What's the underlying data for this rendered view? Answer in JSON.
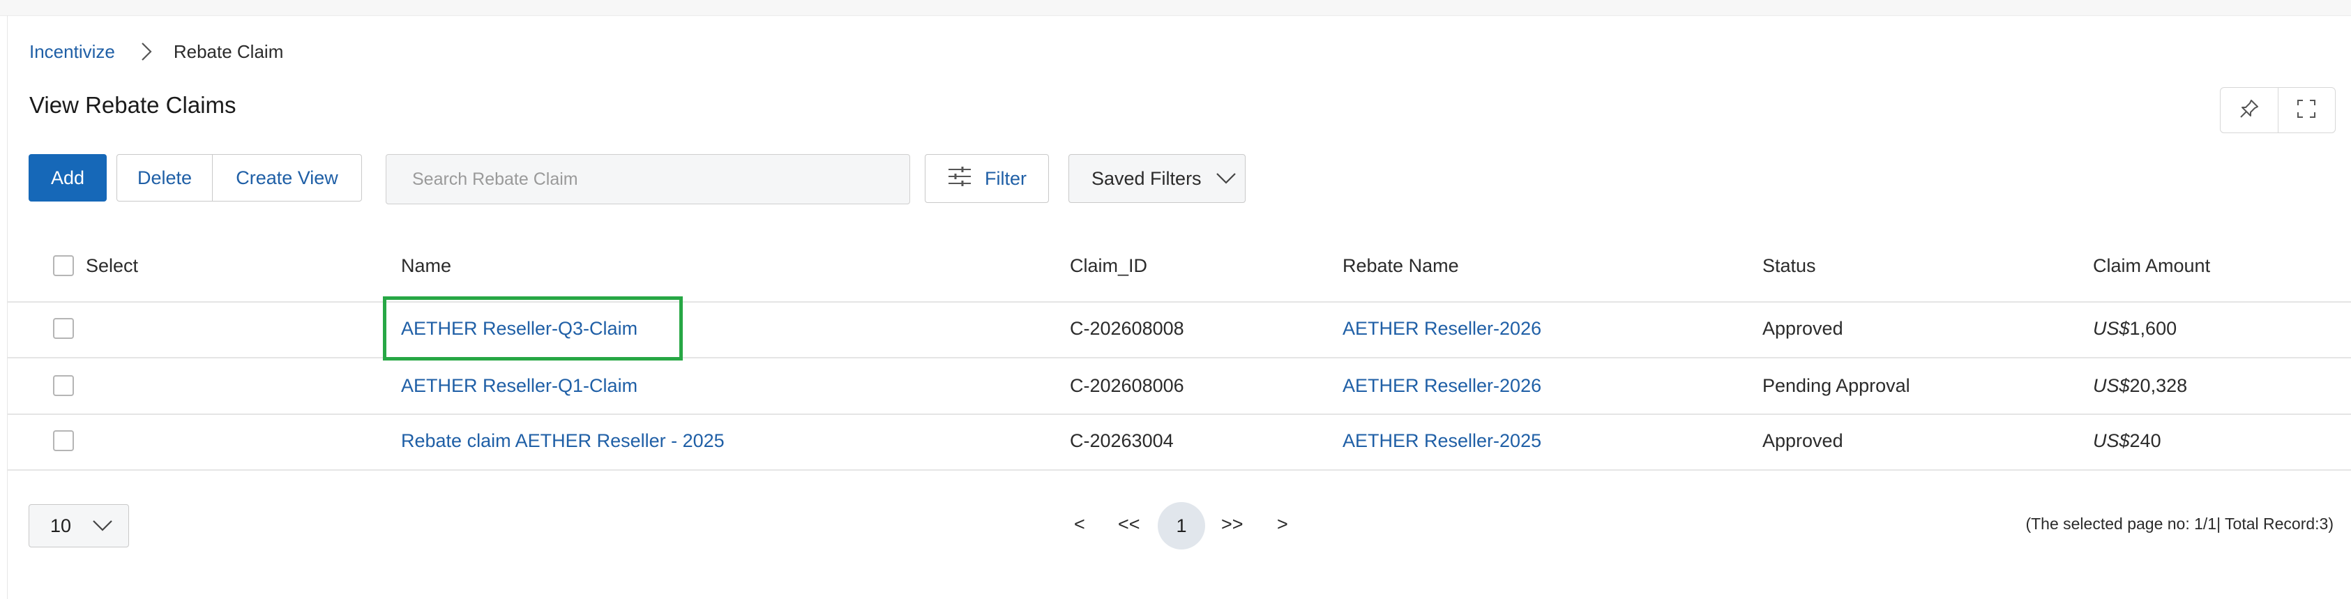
{
  "breadcrumb": {
    "root": "Incentivize",
    "current": "Rebate Claim"
  },
  "page": {
    "title": "View Rebate Claims"
  },
  "toolbar": {
    "add_label": "Add",
    "delete_label": "Delete",
    "create_view_label": "Create View",
    "search_placeholder": "Search Rebate Claim",
    "filter_label": "Filter",
    "saved_filters_label": "Saved Filters"
  },
  "table": {
    "headers": {
      "select": "Select",
      "name": "Name",
      "claim_id": "Claim_ID",
      "rebate_name": "Rebate Name",
      "status": "Status",
      "claim_amount": "Claim Amount"
    },
    "rows": [
      {
        "name": "AETHER Reseller-Q3-Claim",
        "claim_id": "C-202608008",
        "rebate_name": "AETHER Reseller-2026",
        "status": "Approved",
        "currency": "US$",
        "amount": "1,600"
      },
      {
        "name": "AETHER Reseller-Q1-Claim",
        "claim_id": "C-202608006",
        "rebate_name": "AETHER Reseller-2026",
        "status": "Pending Approval",
        "currency": "US$",
        "amount": "20,328"
      },
      {
        "name": "Rebate claim AETHER Reseller - 2025",
        "claim_id": "C-20263004",
        "rebate_name": "AETHER Reseller-2025",
        "status": "Approved",
        "currency": "US$",
        "amount": "240"
      }
    ]
  },
  "pagination": {
    "page_size": "10",
    "prev": "<",
    "first": "<<",
    "current_page": "1",
    "last": ">>",
    "next": ">",
    "record_info": "(The selected page no: 1/1| Total Record:3)"
  },
  "icons": [
    "chevron-right-icon",
    "pin-icon",
    "fullscreen-icon",
    "filter-sliders-icon",
    "chevron-down-icon"
  ],
  "colors": {
    "primary": "#1668b8",
    "link": "#1f5fa6",
    "highlight": "#27a745"
  }
}
